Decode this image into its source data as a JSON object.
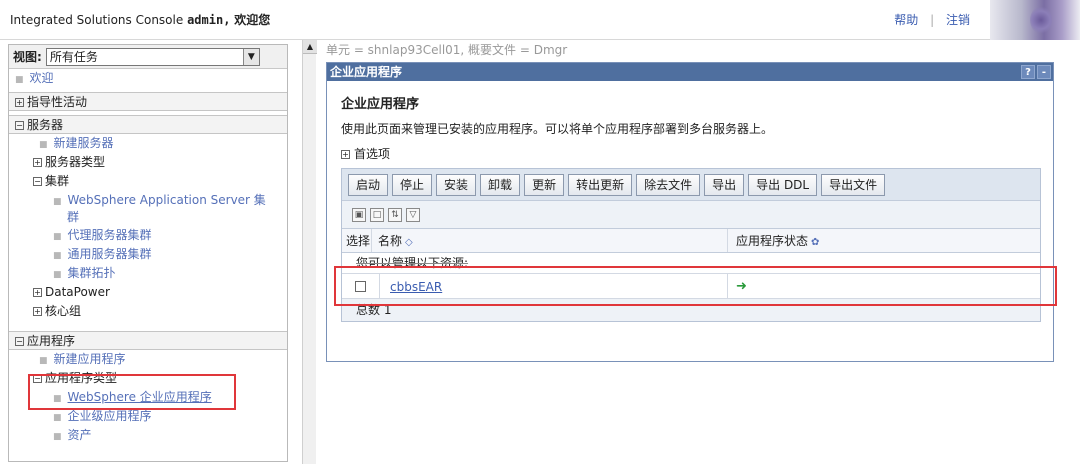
{
  "header": {
    "console_title": "Integrated Solutions Console",
    "user": "admin,",
    "welcome": "欢迎您",
    "help_link": "帮助",
    "separator": "|",
    "logout_link": "注销"
  },
  "nav": {
    "view_label": "视图:",
    "view_selected": "所有任务",
    "welcome": "欢迎",
    "guided": "指导性活动",
    "servers": {
      "label": "服务器",
      "new_server": "新建服务器",
      "server_types": "服务器类型",
      "clusters": "集群",
      "was_cluster_line1": "WebSphere Application Server 集",
      "was_cluster_line2": "群",
      "proxy_cluster": "代理服务器集群",
      "generic_cluster": "通用服务器集群",
      "cluster_topology": "集群拓扑",
      "datapower": "DataPower",
      "core_group": "核心组"
    },
    "applications": {
      "label": "应用程序",
      "new_app": "新建应用程序",
      "app_types": "应用程序类型",
      "websphere_ent_apps": "WebSphere 企业应用程序",
      "business_apps": "企业级应用程序",
      "assets": "资产"
    }
  },
  "main": {
    "breadcrumb": "单元 = shnlap93Cell01, 概要文件 = Dmgr",
    "panel_title": "企业应用程序",
    "help_btn": "?",
    "min_btn": "-",
    "page_title": "企业应用程序",
    "description": "使用此页面来管理已安装的应用程序。可以将单个应用程序部署到多台服务器上。",
    "preferences": "首选项",
    "buttons": [
      "启动",
      "停止",
      "安装",
      "卸载",
      "更新",
      "转出更新",
      "除去文件",
      "导出",
      "导出 DDL",
      "导出文件"
    ],
    "columns": {
      "select": "选择",
      "name": "名称",
      "status": "应用程序状态"
    },
    "manage_text": "您可以管理以下资源:",
    "rows": [
      {
        "name": "cbbsEAR",
        "status": "➜"
      }
    ],
    "total_label": "总数 1"
  }
}
